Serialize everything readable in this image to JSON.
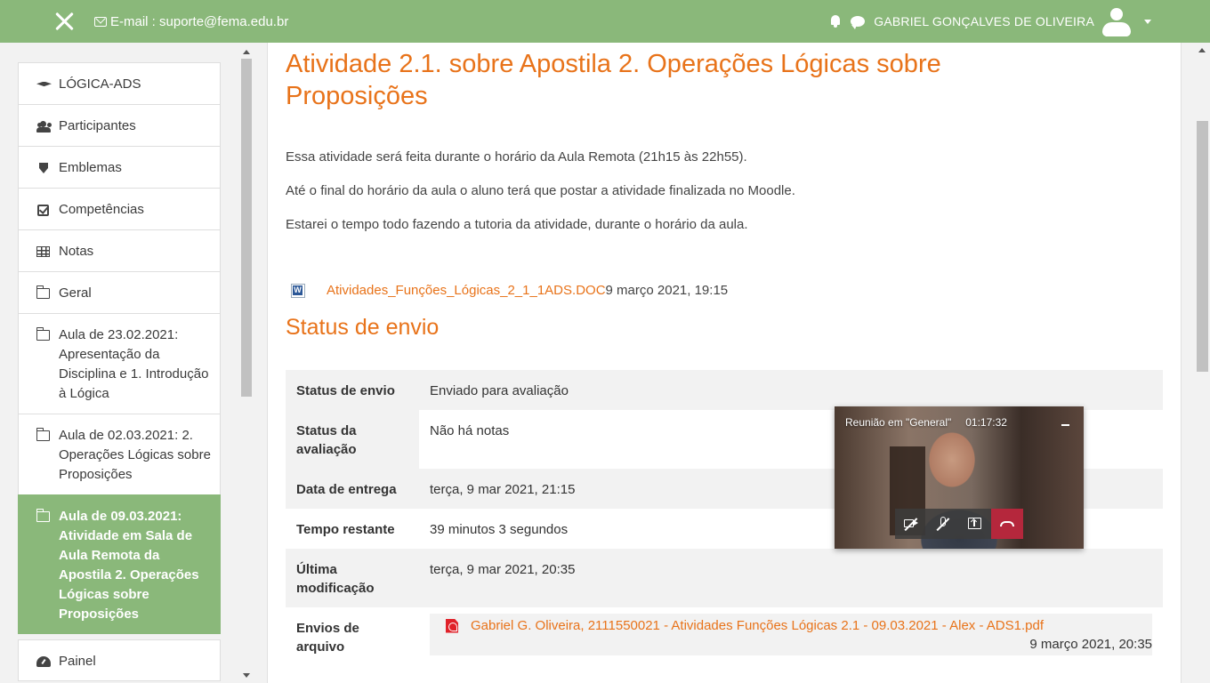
{
  "navbar": {
    "email": "E-mail : suporte@fema.edu.br",
    "user_name": "GABRIEL GONÇALVES DE OLIVEIRA"
  },
  "drawer": {
    "items": [
      {
        "label": "LÓGICA-ADS",
        "icon": "graduation-cap-icon"
      },
      {
        "label": "Participantes",
        "icon": "users-icon"
      },
      {
        "label": "Emblemas",
        "icon": "shield-icon"
      },
      {
        "label": "Competências",
        "icon": "check-square-icon"
      },
      {
        "label": "Notas",
        "icon": "table-icon"
      },
      {
        "label": "Geral",
        "icon": "folder-icon"
      },
      {
        "label": "Aula de 23.02.2021: Apresentação da Disciplina e 1. Introdução à Lógica",
        "icon": "folder-icon"
      },
      {
        "label": "Aula de 02.03.2021: 2. Operações Lógicas sobre Proposições",
        "icon": "folder-icon"
      },
      {
        "label": "Aula de 09.03.2021: Atividade em Sala de Aula Remota da Apostila 2. Operações Lógicas sobre Proposições",
        "icon": "folder-icon",
        "active": true
      },
      {
        "label": "Painel",
        "icon": "dashboard-icon"
      }
    ]
  },
  "main": {
    "title": "Atividade 2.1. sobre Apostila 2. Operações Lógicas sobre Proposições",
    "intro": [
      "Essa atividade será feita durante o horário da Aula Remota (21h15 às 22h55).",
      "Até o final do horário da aula o aluno terá que postar a atividade finalizada no Moodle.",
      "Estarei o tempo todo fazendo a tutoria da atividade, durante o horário da aula."
    ],
    "attachment": {
      "name": "Atividades_Funções_Lógicas_2_1_1ADS.DOC",
      "date": "9 março 2021, 19:15"
    },
    "section_title": "Status de envio",
    "status": {
      "submission_label": "Status de envio",
      "submission_value": "Enviado para avaliação",
      "grading_label": "Status da avaliação",
      "grading_value": "Não há notas",
      "due_label": "Data de entrega",
      "due_value": "terça, 9 mar 2021, 21:15",
      "remaining_label": "Tempo restante",
      "remaining_value": "39 minutos 3 segundos",
      "modified_label": "Última modificação",
      "modified_value": "terça, 9 mar 2021, 20:35",
      "files_label": "Envios de arquivo",
      "file_name": "Gabriel G. Oliveira, 2111550021 - Atividades Funções Lógicas 2.1 - 09.03.2021 - Alex - ADS1.pdf",
      "file_date": "9 março 2021, 20:35"
    }
  },
  "video_call": {
    "title": "Reunião em \"General\"",
    "duration": "01:17:32"
  },
  "colors": {
    "brand_green": "#8ab87a",
    "accent_orange": "#e8731a",
    "hangup_red": "#b5273c"
  }
}
